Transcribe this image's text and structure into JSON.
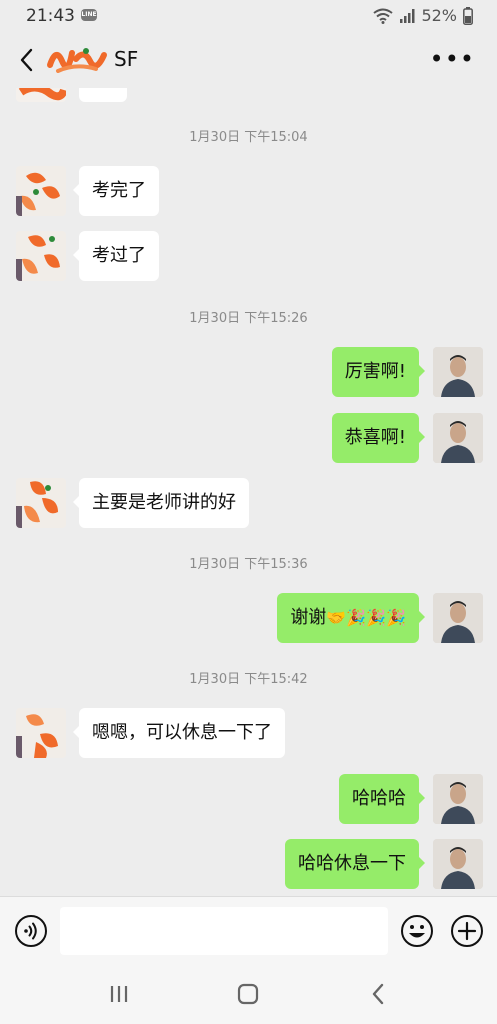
{
  "status_bar": {
    "time": "21:43",
    "line_badge": "LINE",
    "battery": "52%"
  },
  "header": {
    "title": "SF"
  },
  "messages": [
    {
      "kind": "timestamp",
      "text": "1月30日 下午15:04"
    },
    {
      "kind": "msg",
      "side": "left",
      "text": "考完了"
    },
    {
      "kind": "msg",
      "side": "left",
      "text": "考过了"
    },
    {
      "kind": "timestamp",
      "text": "1月30日 下午15:26"
    },
    {
      "kind": "msg",
      "side": "right",
      "text": "厉害啊!"
    },
    {
      "kind": "msg",
      "side": "right",
      "text": "恭喜啊!"
    },
    {
      "kind": "msg",
      "side": "left",
      "text": "主要是老师讲的好"
    },
    {
      "kind": "timestamp",
      "text": "1月30日 下午15:36"
    },
    {
      "kind": "msg",
      "side": "right",
      "text": "谢谢",
      "emoji": "🤝🎉🎉🎉"
    },
    {
      "kind": "timestamp",
      "text": "1月30日 下午15:42"
    },
    {
      "kind": "msg",
      "side": "left",
      "text": "嗯嗯，可以休息一下了"
    },
    {
      "kind": "msg",
      "side": "right",
      "text": "哈哈哈"
    },
    {
      "kind": "msg",
      "side": "right",
      "text": "哈哈休息一下"
    }
  ],
  "colors": {
    "background": "#ededed",
    "bubble_self": "#95ec69",
    "bubble_other": "#ffffff",
    "timestamp": "#8a8a8a"
  },
  "icons": {
    "voice": "voice-icon",
    "emoji": "emoji-icon",
    "plus": "plus-icon",
    "back": "back-arrow-icon",
    "more": "more-icon"
  }
}
